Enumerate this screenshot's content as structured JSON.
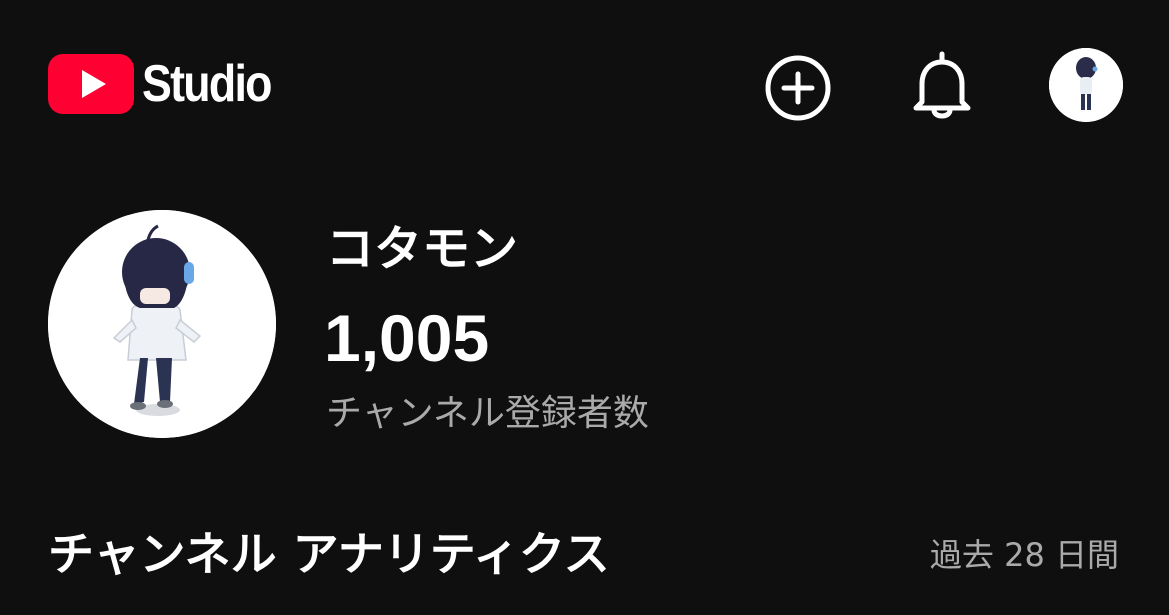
{
  "header": {
    "logo_text": "Studio",
    "brand_color": "#ff0033",
    "icons": {
      "create": "create-icon",
      "notifications": "bell-icon",
      "account": "avatar"
    }
  },
  "channel": {
    "name": "コタモン",
    "subscriber_count": "1,005",
    "subscriber_label": "チャンネル登録者数"
  },
  "analytics": {
    "title": "チャンネル アナリティクス",
    "period": "過去 28 日間"
  },
  "colors": {
    "background": "#0f0f0f",
    "text_primary": "#ffffff",
    "text_secondary": "#aaaaaa"
  }
}
